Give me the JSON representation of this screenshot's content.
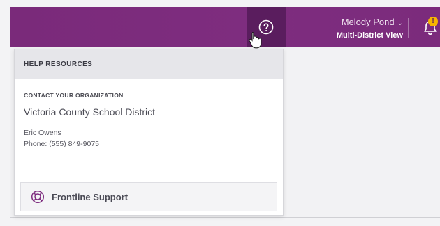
{
  "header": {
    "help_icon": "question-circle-icon",
    "user_name": "Melody Pond",
    "user_chevron": "⌄",
    "user_view": "Multi-District View",
    "notification_icon": "bell-icon",
    "notification_badge": "!"
  },
  "help_panel": {
    "title": "HELP RESOURCES",
    "contact_label": "CONTACT YOUR ORGANIZATION",
    "organization": "Victoria County School District",
    "contact_name": "Eric Owens",
    "contact_phone": "Phone: (555) 849-9075",
    "support_icon": "lifebuoy-icon",
    "support_label": "Frontline Support"
  },
  "colors": {
    "topbar": "#7e2d7f",
    "help_button_active": "#5a1d5e",
    "badge": "#f7b500",
    "support_icon": "#7e2d7f"
  }
}
